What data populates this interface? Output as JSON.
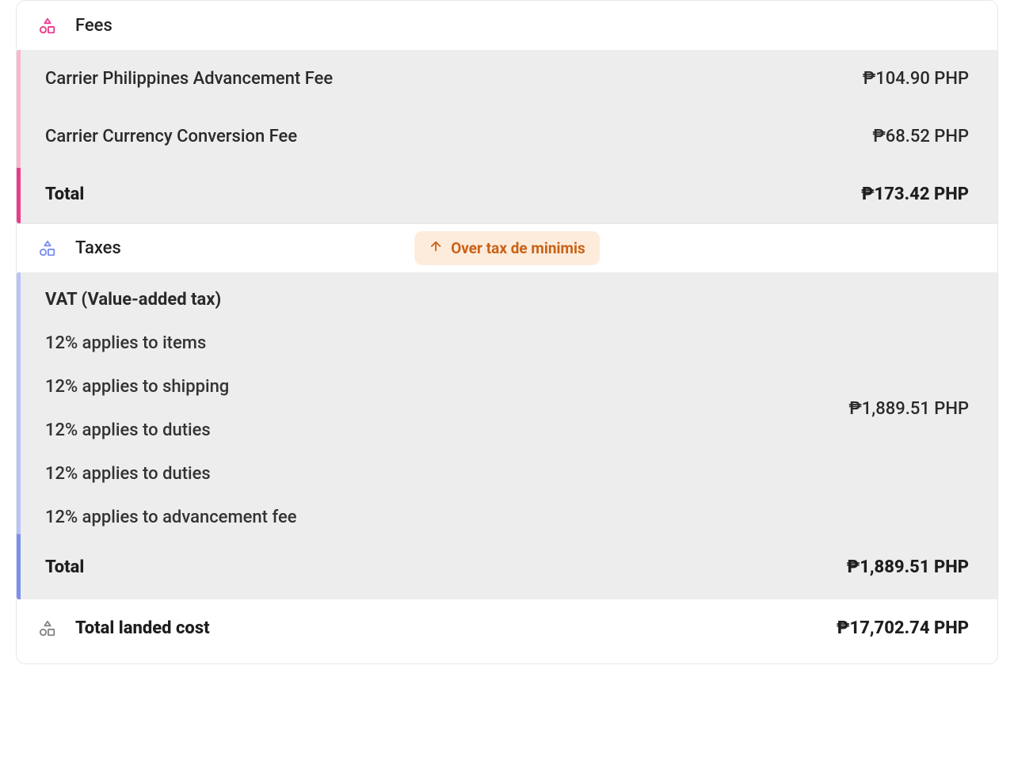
{
  "fees": {
    "title": "Fees",
    "items": [
      {
        "label": "Carrier Philippines Advancement Fee",
        "value": "₱104.90 PHP"
      },
      {
        "label": "Carrier Currency Conversion Fee",
        "value": "₱68.52 PHP"
      }
    ],
    "total_label": "Total",
    "total_value": "₱173.42 PHP"
  },
  "taxes": {
    "title": "Taxes",
    "badge_label": "Over tax de minimis",
    "vat": {
      "title": "VAT (Value-added tax)",
      "sub": [
        "12% applies to items",
        "12% applies to shipping",
        "12% applies to duties",
        "12% applies to duties",
        "12% applies to advancement fee"
      ],
      "value": "₱1,889.51 PHP"
    },
    "total_label": "Total",
    "total_value": "₱1,889.51 PHP"
  },
  "grand_total": {
    "label": "Total landed cost",
    "value": "₱17,702.74 PHP"
  },
  "colors": {
    "badge_bg": "#fdecdc",
    "badge_fg": "#c96217",
    "pink_light": "#f9b6cf",
    "pink_dark": "#ec3a8b",
    "blue_light": "#b8c4f7",
    "blue_dark": "#7b8ff0",
    "gray_text": "#838389"
  },
  "icons": {
    "fees": "shapes-icon-pink",
    "taxes": "shapes-icon-blue",
    "total": "shapes-icon-gray",
    "badge_arrow": "arrow-up-icon"
  }
}
